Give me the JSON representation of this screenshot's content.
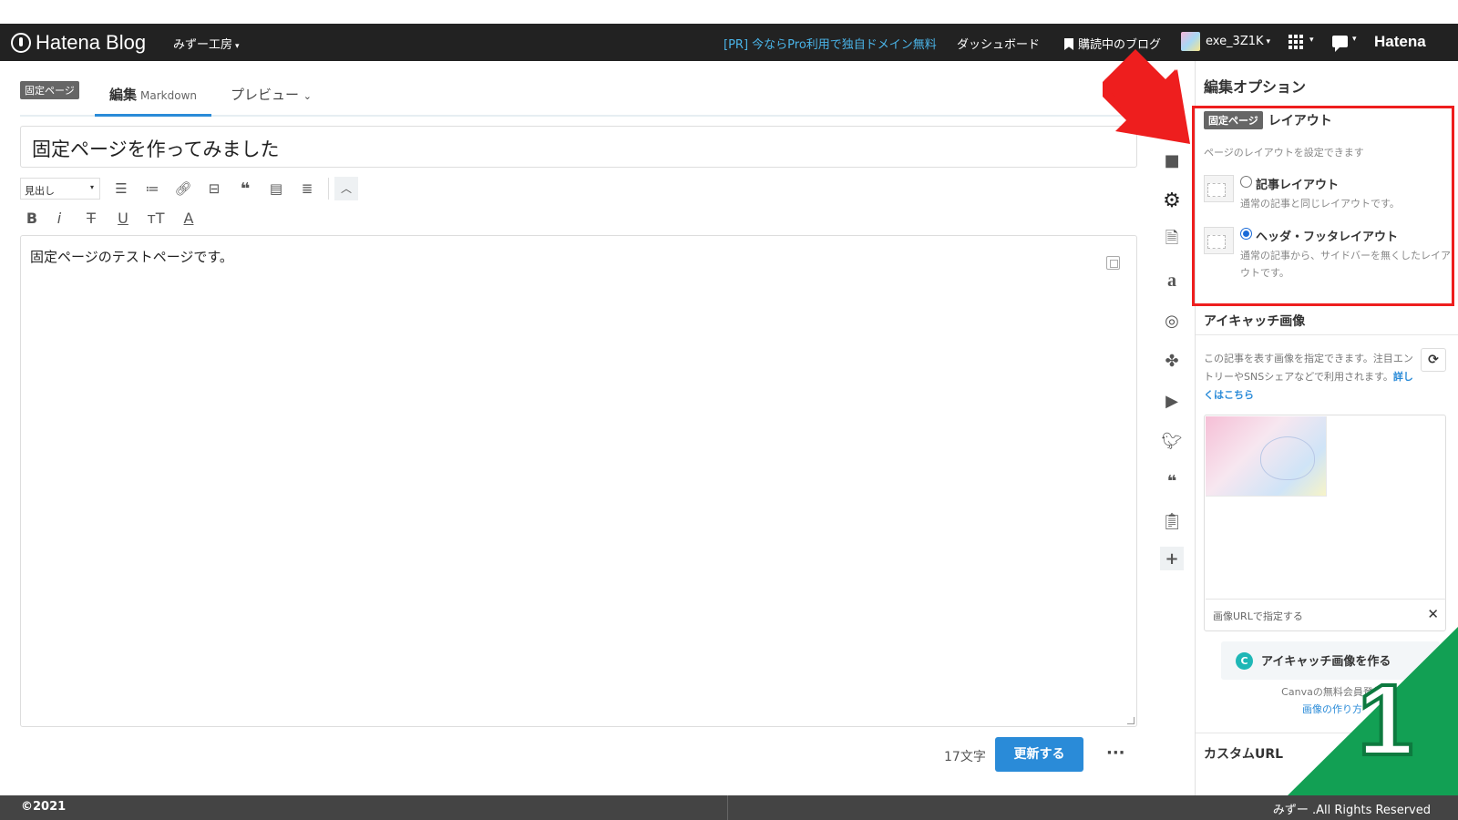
{
  "topbar": {
    "logo": "Hatena Blog",
    "blog_name": "みずー工房",
    "pr_link": "[PR] 今ならPro利用で独自ドメイン無料",
    "dashboard": "ダッシュボード",
    "subscribed": "購読中のブログ",
    "user": "exe_3Z1K",
    "hatena": "Hatena"
  },
  "editor": {
    "page_tag": "固定ページ",
    "tab_edit": "編集",
    "tab_edit_mode": "Markdown",
    "tab_preview": "プレビュー",
    "title": "固定ページを作ってみました",
    "heading_select": "見出し",
    "body": "固定ページのテストページです。",
    "char_count": "17文字",
    "update_button": "更新する",
    "more": "···"
  },
  "format_toolbar": {
    "bold": "B",
    "italic": "i",
    "strike": "T",
    "underline": "U",
    "text_size": "тT",
    "font_color": "A"
  },
  "panel": {
    "title": "編集オプション",
    "layout": {
      "tag": "固定ページ",
      "heading": "レイアウト",
      "description": "ページのレイアウトを設定できます",
      "options": [
        {
          "label": "記事レイアウト",
          "description": "通常の記事と同じレイアウトです。",
          "selected": false
        },
        {
          "label": "ヘッダ・フッタレイアウト",
          "description": "通常の記事から、サイドバーを無くしたレイアウトです。",
          "selected": true
        }
      ]
    },
    "eyecatch": {
      "heading": "アイキャッチ画像",
      "description": "この記事を表す画像を指定できます。注目エントリーやSNSシェアなどで利用されます。",
      "link": "詳しくはこちら",
      "url_label": "画像URLで指定する",
      "canva_button": "アイキャッチ画像を作る",
      "canva_note": "Canvaの無料会員登録",
      "canva_link": "画像の作り方"
    },
    "custom_url": "カスタムURL"
  },
  "annotation": {
    "step_number": "1",
    "highlight_color": "#ee1e1e",
    "step_color": "#12a054"
  },
  "footer": {
    "copyright": "©2021",
    "rights": "みずー .All Rights Reserved"
  }
}
